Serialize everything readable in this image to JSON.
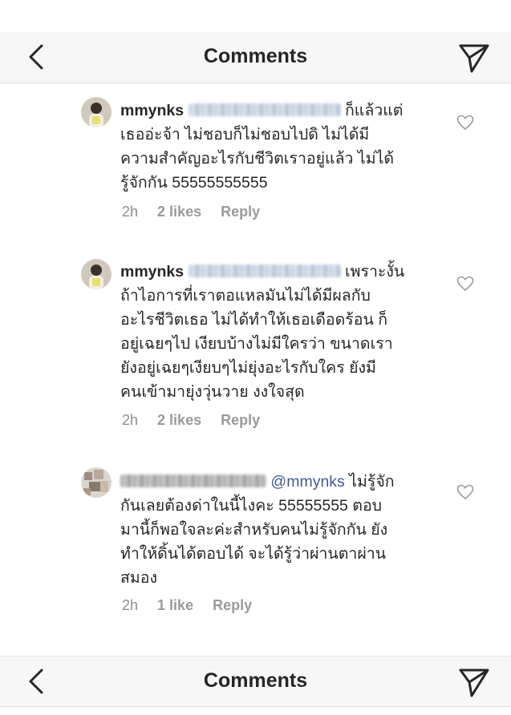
{
  "header": {
    "title": "Comments",
    "back_icon": "chevron-left-icon",
    "send_icon": "paper-plane-icon"
  },
  "comments": [
    {
      "username": "mmynks",
      "text_lines": [
        "ก็แล้วแต่",
        "เธออ่ะจ้า ไม่ชอบก็ไม่ชอบไปดิ ไม่ได้มี",
        "ความสำคัญอะไรกับชีวิตเราอยู่แล้ว ไม่ได้",
        "รู้จักกัน 55555555555"
      ],
      "time": "2h",
      "likes": "2 likes",
      "reply": "Reply"
    },
    {
      "username": "mmynks",
      "text_lines": [
        "เพราะงั้น",
        "ถ้าไอการที่เราตอแหลมันไม่ได้มีผลกับ",
        "อะไรชีวิตเธอ ไม่ได้ทำให้เธอเดือดร้อน ก็",
        "อยู่เฉยๆไป เงียบบ้างไม่มีใครว่า ขนาดเรา",
        "ยังอยู่เฉยๆเงียบๆไม่ยุ่งอะไรกับใคร ยังมี",
        "คนเข้ามายุ่งวุ่นวาย งงใจสุด"
      ],
      "time": "2h",
      "likes": "2 likes",
      "reply": "Reply"
    },
    {
      "mention": "@mmynks",
      "text_lines": [
        "ไม่รู้จัก",
        "กันเลยต้องด่าในนี้ไงคะ 55555555 ตอบ",
        "มานี้ก็พอใจละค่ะสำหรับคนไม่รู้จักกัน ยัง",
        "ทำให้ดิ้นได้ตอบได้ จะได้รู้ว่าผ่านตาผ่าน",
        "สมอง"
      ],
      "time": "2h",
      "likes": "1 like",
      "reply": "Reply"
    }
  ],
  "footer_header": {
    "title": "Comments"
  },
  "colors": {
    "mention": "#3f5a93",
    "meta": "#8e8e8e",
    "text": "#262626",
    "header_bg": "#f7f7f7"
  }
}
